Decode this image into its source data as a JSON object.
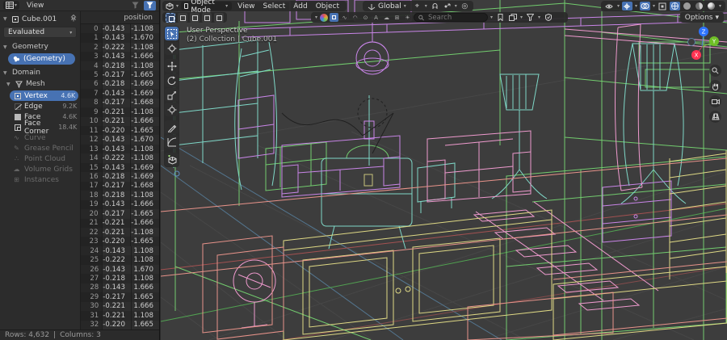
{
  "colors": {
    "accent": "#4772b3",
    "bg": "#3d3d3d",
    "grid": "#474747",
    "wire-green": "#72cc6e",
    "wire-mint": "#7fd8c8",
    "wire-violet": "#c985e8",
    "wire-pink": "#ef9ace",
    "wire-yellow": "#dfd985",
    "wire-salmon": "#e8938a",
    "axis-red": "#b65555",
    "axis-blue": "#5b80a4",
    "origin-orange": "#ffa03e"
  },
  "spreadsheet": {
    "menu_view": "View",
    "sidebar": {
      "object_name": "Cube.001",
      "dataset_dropdown": "Evaluated",
      "section_geometry": "Geometry",
      "geometry_button": "(Geometry)",
      "section_domain": "Domain",
      "mesh_label": "Mesh",
      "mesh_items": [
        {
          "label": "Vertex",
          "count": "4.6K",
          "icon": "g-vertex",
          "selected": true
        },
        {
          "label": "Edge",
          "count": "9.2K",
          "icon": "g-edge",
          "selected": false
        },
        {
          "label": "Face",
          "count": "4.6K",
          "icon": "g-face",
          "selected": false
        },
        {
          "label": "Face Corner",
          "count": "18.4K",
          "icon": "g-corner",
          "selected": false
        }
      ],
      "disabled_items": [
        {
          "label": "Curve",
          "glyph": "∿"
        },
        {
          "label": "Grease Pencil",
          "glyph": "✎"
        },
        {
          "label": "Point Cloud",
          "glyph": "∴"
        },
        {
          "label": "Volume Grids",
          "glyph": "☁"
        },
        {
          "label": "Instances",
          "glyph": "⊞"
        }
      ]
    },
    "table": {
      "column_header": "position",
      "rows": [
        [
          "0",
          "-0.143",
          "-1.108"
        ],
        [
          "1",
          "-0.143",
          "-1.670"
        ],
        [
          "2",
          "-0.222",
          "-1.108"
        ],
        [
          "3",
          "-0.143",
          "-1.666"
        ],
        [
          "4",
          "-0.218",
          "-1.108"
        ],
        [
          "5",
          "-0.217",
          "-1.665"
        ],
        [
          "6",
          "-0.218",
          "-1.669"
        ],
        [
          "7",
          "-0.143",
          "-1.669"
        ],
        [
          "8",
          "-0.217",
          "-1.668"
        ],
        [
          "9",
          "-0.221",
          "-1.108"
        ],
        [
          "10",
          "-0.221",
          "-1.666"
        ],
        [
          "11",
          "-0.220",
          "-1.665"
        ],
        [
          "12",
          "-0.143",
          "-1.670"
        ],
        [
          "13",
          "-0.143",
          "-1.108"
        ],
        [
          "14",
          "-0.222",
          "-1.108"
        ],
        [
          "15",
          "-0.143",
          "-1.669"
        ],
        [
          "16",
          "-0.218",
          "-1.669"
        ],
        [
          "17",
          "-0.217",
          "-1.668"
        ],
        [
          "18",
          "-0.218",
          "-1.108"
        ],
        [
          "19",
          "-0.143",
          "-1.666"
        ],
        [
          "20",
          "-0.217",
          "-1.665"
        ],
        [
          "21",
          "-0.221",
          "-1.666"
        ],
        [
          "22",
          "-0.221",
          "-1.108"
        ],
        [
          "23",
          "-0.220",
          "-1.665"
        ],
        [
          "24",
          "-0.143",
          "1.108"
        ],
        [
          "25",
          "-0.222",
          "1.108"
        ],
        [
          "26",
          "-0.143",
          "1.670"
        ],
        [
          "27",
          "-0.218",
          "1.108"
        ],
        [
          "28",
          "-0.143",
          "1.666"
        ],
        [
          "29",
          "-0.217",
          "1.665"
        ],
        [
          "30",
          "-0.221",
          "1.666"
        ],
        [
          "31",
          "-0.221",
          "1.108"
        ],
        [
          "32",
          "-0.220",
          "1.665"
        ]
      ]
    },
    "status": {
      "rows": "Rows: 4,632",
      "sep": "|",
      "columns": "Columns: 3"
    }
  },
  "viewport": {
    "header": {
      "mode": "Object Mode",
      "menus": [
        "View",
        "Select",
        "Add",
        "Object"
      ],
      "orientation": "Global",
      "search_placeholder": "Search",
      "options_label": "Options",
      "object_type_glyphs": [
        "∿",
        "◠",
        "⊙",
        "A",
        "☁",
        "⊞",
        "☀"
      ]
    },
    "overlay": {
      "perspective": "User Perspective",
      "breadcrumb": "(2) Collection | Cube.001"
    },
    "gizmo_axes": {
      "x": "X",
      "y": "Y",
      "z": "Z"
    }
  }
}
